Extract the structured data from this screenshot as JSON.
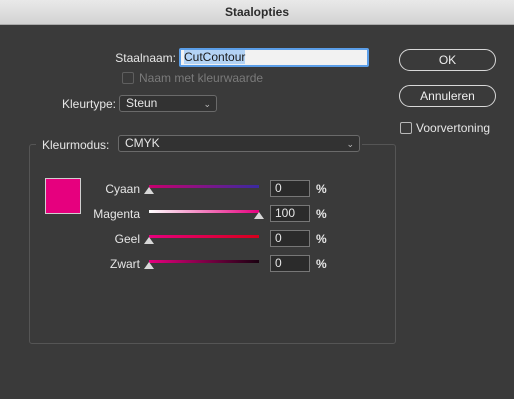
{
  "window": {
    "title": "Staalopties"
  },
  "form": {
    "name_label": "Staalnaam:",
    "name_value": "CutContour",
    "name_by_value_label": "Naam met kleurwaarde",
    "color_type_label": "Kleurtype:",
    "color_type_value": "Steun",
    "color_mode_label": "Kleurmodus:",
    "color_mode_value": "CMYK"
  },
  "buttons": {
    "ok": "OK",
    "cancel": "Annuleren",
    "preview_label": "Voorvertoning"
  },
  "swatch_color": "#e6007e",
  "channels": [
    {
      "label": "Cyaan",
      "value": "0",
      "percent": "%",
      "fraction": 0.0,
      "track": [
        "#c8006e",
        "#3a2aa0"
      ]
    },
    {
      "label": "Magenta",
      "value": "100",
      "percent": "%",
      "fraction": 1.0,
      "track": [
        "#ffffff",
        "#e6007e"
      ]
    },
    {
      "label": "Geel",
      "value": "0",
      "percent": "%",
      "fraction": 0.0,
      "track": [
        "#e6007e",
        "#d6001c"
      ]
    },
    {
      "label": "Zwart",
      "value": "0",
      "percent": "%",
      "fraction": 0.0,
      "track": [
        "#e6007e",
        "#1a0010"
      ]
    }
  ]
}
